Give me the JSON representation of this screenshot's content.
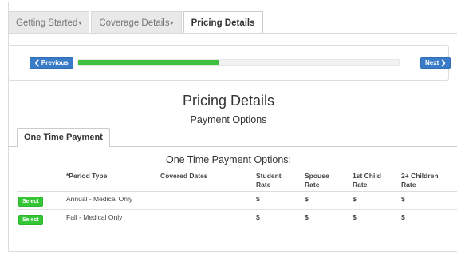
{
  "wizard_tabs": [
    {
      "label": "Getting Started",
      "has_caret": true,
      "active": false
    },
    {
      "label": "Coverage Details",
      "has_caret": true,
      "active": false
    },
    {
      "label": "Pricing Details",
      "has_caret": false,
      "active": true
    }
  ],
  "progress": {
    "previous_label": "❮ Previous",
    "next_label": "Next ❯",
    "percent": 44
  },
  "page": {
    "title": "Pricing Details",
    "subtitle": "Payment Options"
  },
  "payment_tab": {
    "label": "One Time Payment"
  },
  "options_title": "One Time Payment Options:",
  "table": {
    "headers": {
      "period_type": "*Period Type",
      "covered_dates": "Covered Dates",
      "student_rate": [
        "Student",
        "Rate"
      ],
      "spouse_rate": [
        "Spouse",
        "Rate"
      ],
      "child1_rate": [
        "1st Child",
        "Rate"
      ],
      "child2_rate": [
        "2+ Children",
        "Rate"
      ]
    },
    "rows": [
      {
        "select_label": "Select",
        "period_type": "Annual - Medical Only",
        "covered_dates": "",
        "student": "$",
        "spouse": "$",
        "child1": "$",
        "child2": "$"
      },
      {
        "select_label": "Select",
        "period_type": "Fall - Medical Only",
        "covered_dates": "",
        "student": "$",
        "spouse": "$",
        "child1": "$",
        "child2": "$"
      }
    ]
  },
  "colors": {
    "primary_button": "#3a7bc8",
    "progress_fill": "#3fc13f",
    "select_button": "#34c634"
  }
}
